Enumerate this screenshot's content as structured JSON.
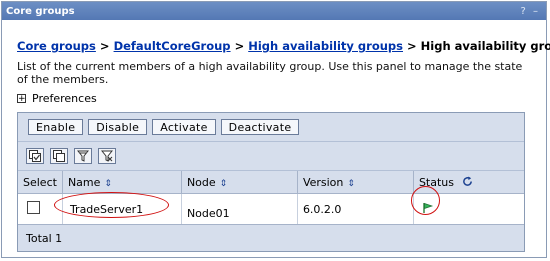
{
  "window": {
    "title": "Core groups",
    "controls": "? –"
  },
  "breadcrumb": {
    "links": [
      "Core groups",
      "DefaultCoreGroup",
      "High availability groups"
    ],
    "separator": ">",
    "current": "High availability group"
  },
  "description": "List of the current members of a high availability group. Use this panel to manage the state of the members.",
  "preferences": {
    "label": "Preferences",
    "expander": "+"
  },
  "toolbar": {
    "buttons": [
      "Enable",
      "Disable",
      "Activate",
      "Deactivate"
    ]
  },
  "icon_toolbar": [
    "select-all-icon",
    "deselect-all-icon",
    "show-filter-icon",
    "clear-filter-icon"
  ],
  "table": {
    "headers": {
      "select": "Select",
      "name": "Name",
      "node": "Node",
      "version": "Version",
      "status": "Status"
    },
    "rows": [
      {
        "name": "TradeServer1",
        "node": "Node01",
        "version": "6.0.2.0",
        "status": "active-flag-icon"
      }
    ],
    "total": "Total 1"
  },
  "colors": {
    "title_bar": "#5f82bc",
    "link": "#0033aa",
    "highlight_oval": "#d01010",
    "status_icon": "#2a9d4a"
  }
}
